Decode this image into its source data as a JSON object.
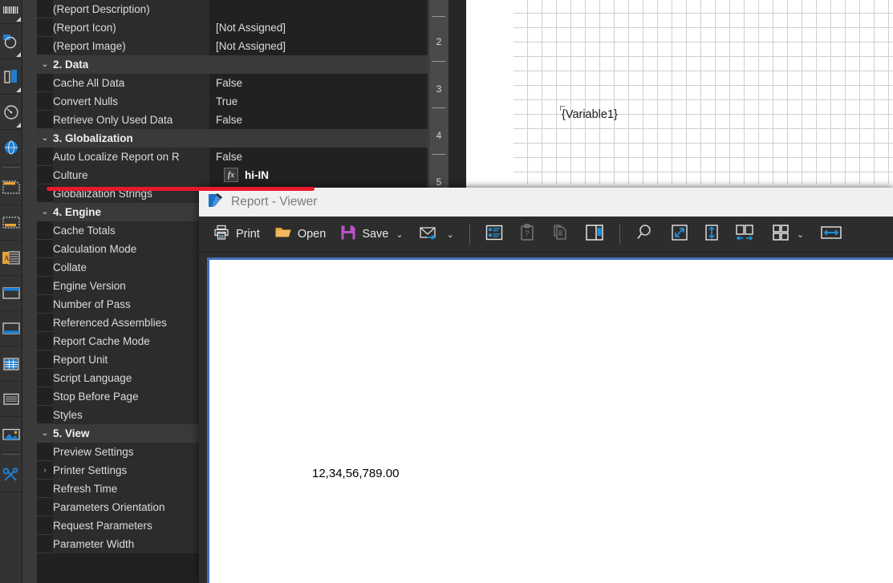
{
  "toolbox": {
    "items": [
      {
        "name": "barcode-tool",
        "icon": "barcode"
      },
      {
        "name": "chart-tool",
        "icon": "pie-chart"
      },
      {
        "name": "bar-chart-tool",
        "icon": "bar-chart"
      },
      {
        "name": "gauge-tool",
        "icon": "gauge"
      },
      {
        "name": "map-tool",
        "icon": "globe"
      },
      {
        "name": "separator-1",
        "icon": "separator"
      },
      {
        "name": "header-band-tool",
        "icon": "header-band"
      },
      {
        "name": "footer-band-tool",
        "icon": "footer-band"
      },
      {
        "name": "text-band-tool",
        "icon": "text-band"
      },
      {
        "name": "panel-tool",
        "icon": "panel"
      },
      {
        "name": "page-header-tool",
        "icon": "page-header"
      },
      {
        "name": "page-footer-tool",
        "icon": "page-footer"
      },
      {
        "name": "table-tool",
        "icon": "table"
      },
      {
        "name": "text-lines-tool",
        "icon": "text-lines"
      },
      {
        "name": "image-tool",
        "icon": "image"
      },
      {
        "name": "separator-2",
        "icon": "separator"
      },
      {
        "name": "tools-tool",
        "icon": "tools"
      }
    ]
  },
  "property_grid": {
    "rows": [
      {
        "kind": "prop",
        "name": "(Report Description)",
        "value": ""
      },
      {
        "kind": "prop",
        "name": "(Report Icon)",
        "value": "[Not Assigned]"
      },
      {
        "kind": "prop",
        "name": "(Report Image)",
        "value": "[Not Assigned]"
      },
      {
        "kind": "cat",
        "name": "2. Data",
        "value": "",
        "expander": "v"
      },
      {
        "kind": "prop",
        "name": "Cache All Data",
        "value": "False"
      },
      {
        "kind": "prop",
        "name": "Convert Nulls",
        "value": "True"
      },
      {
        "kind": "prop",
        "name": "Retrieve Only Used Data",
        "value": "False"
      },
      {
        "kind": "cat",
        "name": "3. Globalization",
        "value": "",
        "expander": "v"
      },
      {
        "kind": "prop",
        "name": "Auto Localize Report on R",
        "value": "False"
      },
      {
        "kind": "prop-fx",
        "name": "Culture",
        "value": "hi-IN",
        "fx": "fx"
      },
      {
        "kind": "prop",
        "name": "Globalization Strings",
        "value": ""
      },
      {
        "kind": "cat",
        "name": "4. Engine",
        "value": "",
        "expander": "v"
      },
      {
        "kind": "prop",
        "name": "Cache Totals",
        "value": ""
      },
      {
        "kind": "prop",
        "name": "Calculation Mode",
        "value": ""
      },
      {
        "kind": "prop",
        "name": "Collate",
        "value": ""
      },
      {
        "kind": "prop",
        "name": "Engine Version",
        "value": ""
      },
      {
        "kind": "prop",
        "name": "Number of Pass",
        "value": ""
      },
      {
        "kind": "prop",
        "name": "Referenced Assemblies",
        "value": ""
      },
      {
        "kind": "prop",
        "name": "Report Cache Mode",
        "value": ""
      },
      {
        "kind": "prop",
        "name": "Report Unit",
        "value": ""
      },
      {
        "kind": "prop",
        "name": "Script Language",
        "value": ""
      },
      {
        "kind": "prop",
        "name": "Stop Before Page",
        "value": ""
      },
      {
        "kind": "prop",
        "name": "Styles",
        "value": ""
      },
      {
        "kind": "cat",
        "name": "5. View",
        "value": "",
        "expander": "v"
      },
      {
        "kind": "prop",
        "name": "Preview Settings",
        "value": ""
      },
      {
        "kind": "prop",
        "name": "Printer Settings",
        "value": "",
        "expander": ">"
      },
      {
        "kind": "prop",
        "name": "Refresh Time",
        "value": ""
      },
      {
        "kind": "prop",
        "name": "Parameters Orientation",
        "value": ""
      },
      {
        "kind": "prop",
        "name": "Request Parameters",
        "value": ""
      },
      {
        "kind": "prop",
        "name": "Parameter Width",
        "value": ""
      }
    ]
  },
  "designer": {
    "ruler_marks": [
      "2",
      "3",
      "4",
      "5"
    ],
    "variable_label": "{Variable1}"
  },
  "viewer": {
    "title": "Report - Viewer",
    "toolbar": {
      "print_label": "Print",
      "open_label": "Open",
      "save_label": "Save",
      "buttons": [
        {
          "name": "print-button",
          "label": "Print",
          "icon": "printer-icon"
        },
        {
          "name": "open-button",
          "label": "Open",
          "icon": "folder-icon"
        },
        {
          "name": "save-button",
          "label": "Save",
          "icon": "save-floppy-icon"
        },
        {
          "name": "send-email-button",
          "label": "",
          "icon": "envelope-icon"
        },
        {
          "name": "parameters-panel-button",
          "label": "",
          "icon": "parameters-panel-icon"
        },
        {
          "name": "clipboard-question-button",
          "label": "",
          "icon": "clipboard-question-icon"
        },
        {
          "name": "copy-page-button",
          "label": "",
          "icon": "copy-page-icon"
        },
        {
          "name": "bookmarks-panel-button",
          "label": "",
          "icon": "bookmarks-panel-icon"
        },
        {
          "name": "zoom-button",
          "label": "",
          "icon": "magnifier-icon"
        },
        {
          "name": "zoom-page-width-button",
          "label": "",
          "icon": "fit-diagonal-icon"
        },
        {
          "name": "zoom-page-height-button",
          "label": "",
          "icon": "fit-vertical-icon"
        },
        {
          "name": "two-page-view-button",
          "label": "",
          "icon": "two-page-icon"
        },
        {
          "name": "multi-page-view-button",
          "label": "",
          "icon": "four-page-icon"
        },
        {
          "name": "fit-width-button",
          "label": "",
          "icon": "fit-width-icon"
        }
      ]
    },
    "page": {
      "amount": "12,34,56,789.00"
    }
  },
  "annotation": {
    "name": "red-underline-highlight",
    "color": "#e8192c"
  },
  "colors": {
    "panel_bg": "#212121",
    "category_bg": "#3a3a3a",
    "toolbar_bg": "#2d2d2d",
    "titlebar_bg": "#f0f0f0",
    "page_border": "#3f6fbf",
    "accent_blue": "#1e90d8",
    "save_magenta": "#bb52c8",
    "folder_orange": "#e8a33d"
  }
}
